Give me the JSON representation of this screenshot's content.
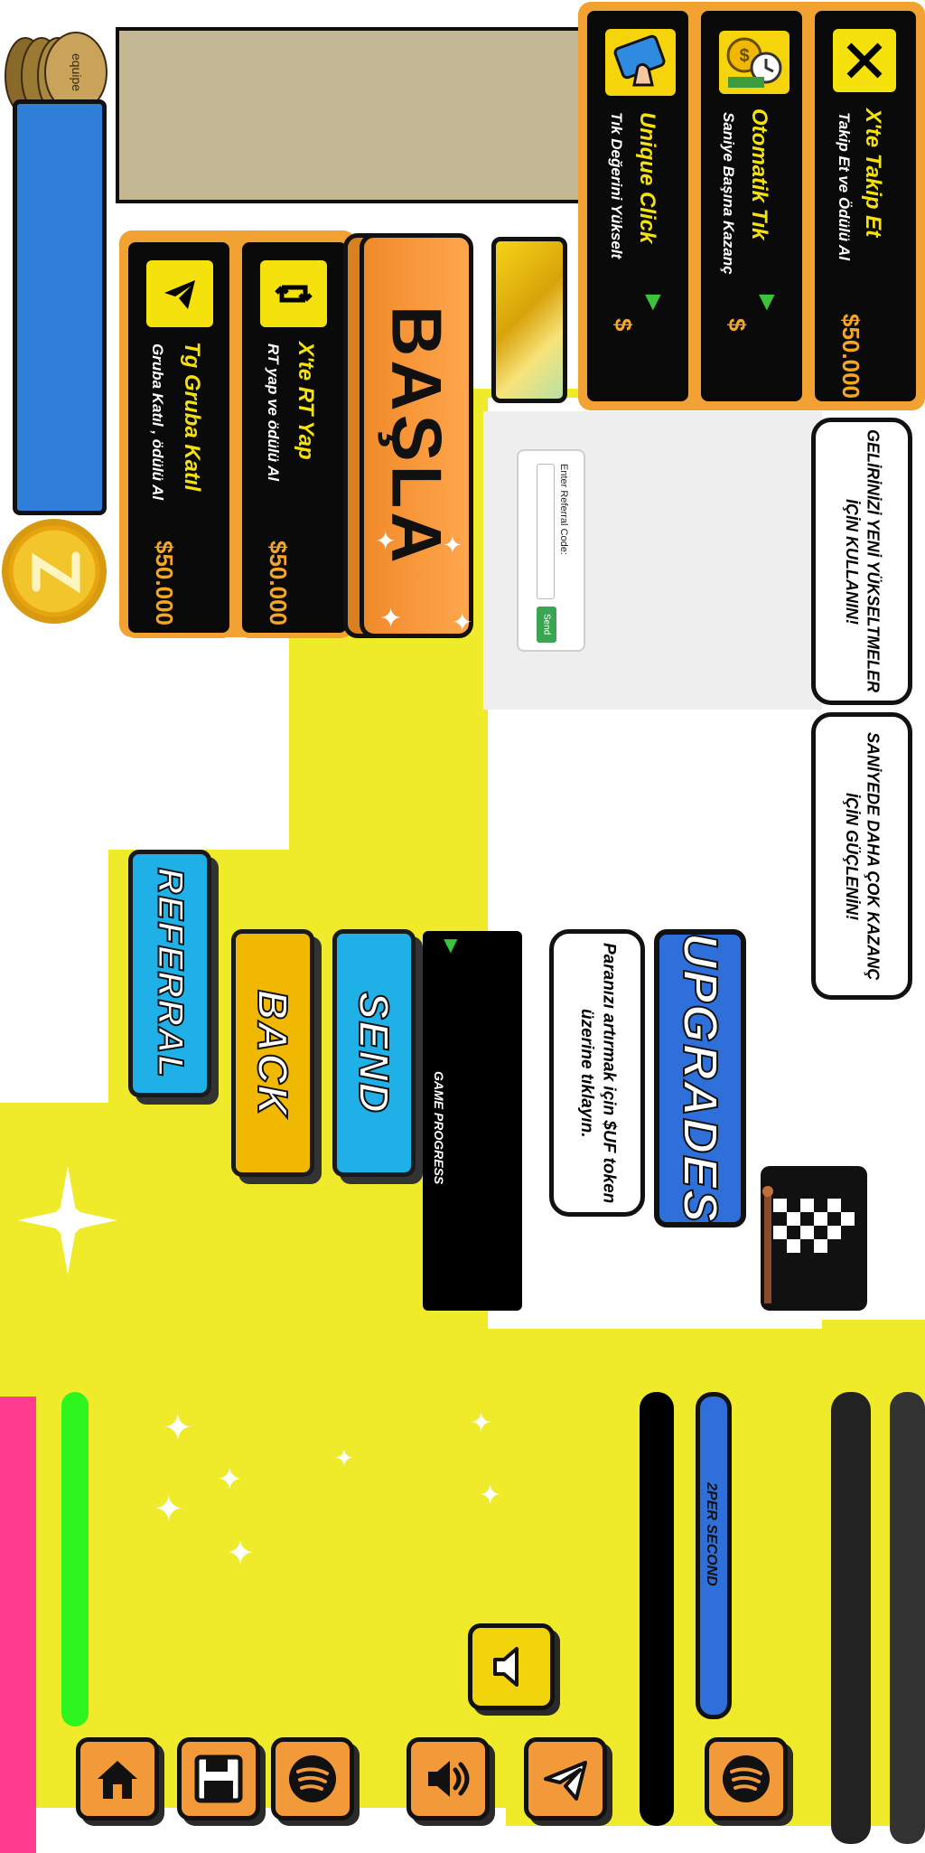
{
  "tasks_top": [
    {
      "title": "X'te Takip Et",
      "subtitle": "Takip Et ve Ödülü Al",
      "price": "$50.000",
      "icon": "x-logo-icon"
    },
    {
      "title": "Otomatik Tık",
      "subtitle": "Saniye Başına Kazanç",
      "price": "$",
      "icon": "money-clock-icon"
    },
    {
      "title": "Unique Click",
      "subtitle": "Tık Değerini Yükselt",
      "price": "$",
      "icon": "phone-tap-icon"
    }
  ],
  "tasks_left": [
    {
      "title": "X'te RT Yap",
      "subtitle": "RT yap ve ödülü Al",
      "price": "$50.000",
      "icon": "retweet-icon"
    },
    {
      "title": "Tg Gruba Katıl",
      "subtitle": "Gruba Katıl , ödülü Al",
      "price": "$50.000",
      "icon": "telegram-icon"
    }
  ],
  "start_label": "BAŞLA",
  "pills": {
    "upgrades_info": "GELİRİNİZİ YENİ YÜKSELTMELER İÇİN KULLANIN!",
    "power_info": "SANİYEDE DAHA ÇOK KAZANÇ İÇİN GÜÇLENİN!",
    "token_info": "Paranızı artırmak için $UF token üzerine tıklayın."
  },
  "referral_form": {
    "label": "Enter Referral Code:",
    "placeholder": "",
    "send": "Send"
  },
  "buttons": {
    "upgrades": "UPGRADES",
    "send": "SEND",
    "back": "BACK",
    "referral": "REFERRAL"
  },
  "game_progress_label": "GAME PROGRESS",
  "per_second_label": "2PER SECOND",
  "coin_brand": "equipe",
  "colors": {
    "accent_orange": "#f29a3a",
    "yellow": "#efeb2a",
    "blue": "#2f6fd9",
    "cyan": "#1eb0e6",
    "gold": "#f0b800"
  }
}
